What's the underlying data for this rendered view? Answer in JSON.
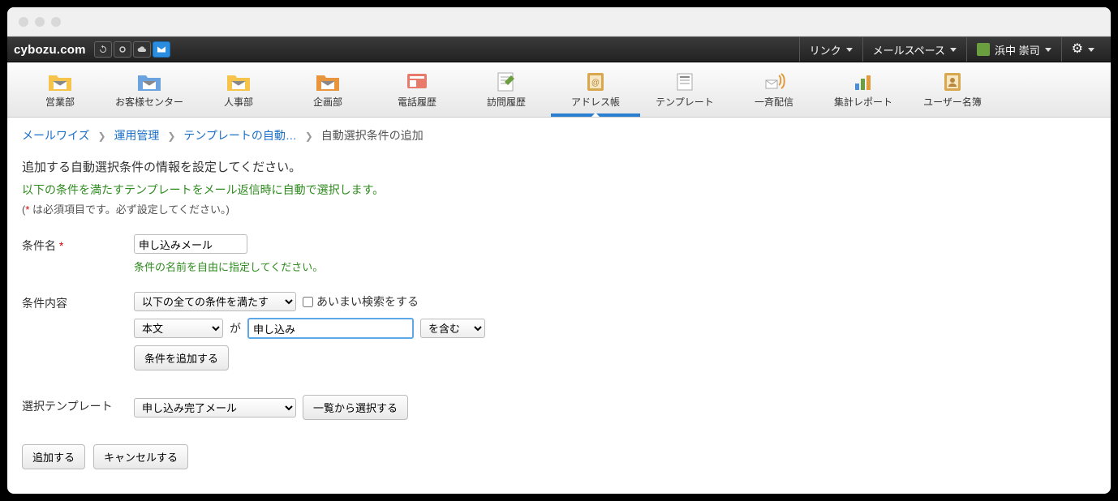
{
  "brand": "cybozu.com",
  "top_menus": {
    "links": "リンク",
    "mailspace": "メールスペース",
    "user": "浜中 崇司"
  },
  "toolbar": [
    {
      "label": "営業部"
    },
    {
      "label": "お客様センター"
    },
    {
      "label": "人事部"
    },
    {
      "label": "企画部"
    },
    {
      "label": "電話履歴"
    },
    {
      "label": "訪問履歴"
    },
    {
      "label": "アドレス帳"
    },
    {
      "label": "テンプレート"
    },
    {
      "label": "一斉配信"
    },
    {
      "label": "集計レポート"
    },
    {
      "label": "ユーザー名簿"
    }
  ],
  "breadcrumb": {
    "items": [
      "メールワイズ",
      "運用管理",
      "テンプレートの自動…"
    ],
    "current": "自動選択条件の追加"
  },
  "lead": "追加する自動選択条件の情報を設定してください。",
  "green_line": "以下の条件を満たすテンプレートをメール返信時に自動で選択します。",
  "note_prefix": "(",
  "note_red": "*",
  "note_rest": " は必須項目です。必ず設定してください。)",
  "fields": {
    "name_label": "条件名",
    "name_value": "申し込みメール",
    "name_hint": "条件の名前を自由に指定してください。",
    "cond_label": "条件内容",
    "match_select": "以下の全ての条件を満たす",
    "fuzzy_label": "あいまい検索をする",
    "field_select": "本文",
    "ga": "が",
    "value_input": "申し込み",
    "op_select": "を含む",
    "add_cond_btn": "条件を追加する",
    "template_label": "選択テンプレート",
    "template_select": "申し込み完了メール",
    "pick_list_btn": "一覧から選択する"
  },
  "actions": {
    "submit": "追加する",
    "cancel": "キャンセルする"
  }
}
